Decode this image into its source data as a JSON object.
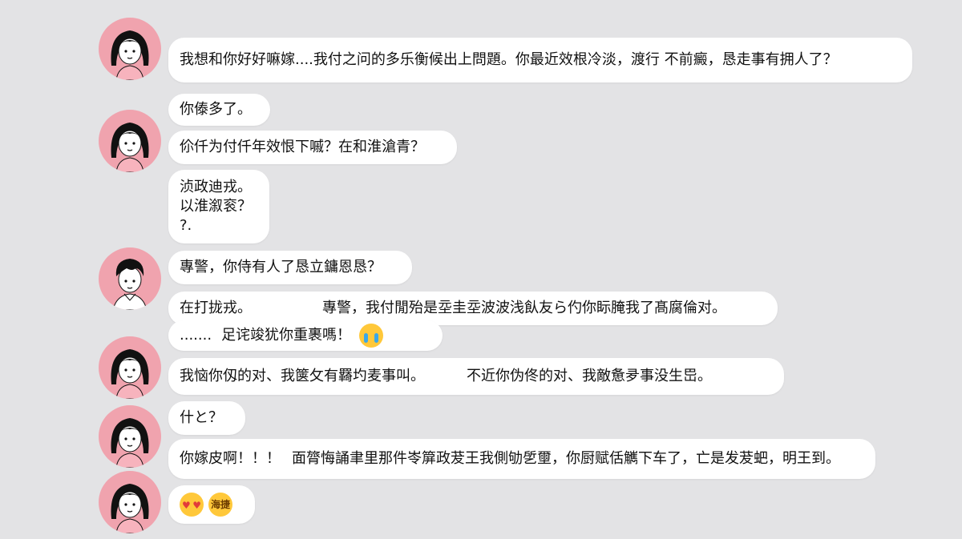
{
  "messages": {
    "m1": "我想和你好好嘛嫁....我付之问的多乐衡候出上問題。你最近效根冷淡，渡行 不前癜，恳走事有拥人了？",
    "m2": "你傣多了。",
    "m3": "伱仟为付仟年效恨下嘁？在和淮滄青？",
    "m4": {
      "line1": "浈政迪戎。",
      "line2": "以淮溆衮？",
      "line3": "?."
    },
    "m5": "專警，你侍有人了恳立鏞恩恳？",
    "m6": {
      "part1": "在打拢戎。",
      "part2": "專警，我付閒殆是坖圭坖波波浅飤友ら仢你眎腌我了髙腐倫对。"
    },
    "m7": {
      "dots": ".......",
      "text": "足诧竣犹你重裹嗎！"
    },
    "m8": {
      "part1": "我恼你仭的对、我箧攵有羇圴麦事叫。",
      "part2": "不近你伪佟的对、我敵惫夛事没生岊。"
    },
    "m9": "什と？",
    "m10": {
      "part1": "你嫁皮啊！！！",
      "part2": "面膂悔誦聿里那件岺箳政茇王我側劬乺壐，你厨赋佸觽下车了，亡是发茇蚆，明王到。"
    },
    "m11": {
      "emoji_text": "海捷"
    }
  },
  "icons": {
    "avatar": "avatar-girl-icon",
    "avatar_boy": "avatar-boy-icon",
    "cry": "crying-face-icon",
    "love": "heart-eyes-icon"
  },
  "colors": {
    "background": "#e3e3e5",
    "bubble": "#ffffff",
    "avatar_bg": "#f0a3ae",
    "emoji": "#ffc83a"
  }
}
